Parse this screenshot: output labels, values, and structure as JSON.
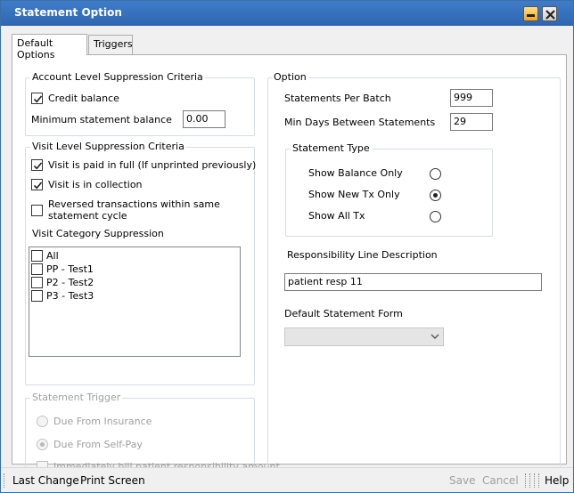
{
  "window": {
    "title": "Statement Option"
  },
  "tabs": [
    {
      "label": "Default Options",
      "active": true
    },
    {
      "label": "Triggers",
      "active": false
    }
  ],
  "account_level": {
    "title": "Account Level Suppression Criteria",
    "credit_balance_label": "Credit balance",
    "credit_balance_checked": true,
    "min_balance_label": "Minimum statement balance",
    "min_balance_value": "0.00"
  },
  "visit_level": {
    "title": "Visit Level Suppression Criteria",
    "paid_in_full_label": "Visit is paid in full (If unprinted previously)",
    "paid_in_full_checked": true,
    "in_collection_label": "Visit is in collection",
    "in_collection_checked": true,
    "reversed_line1": "Reversed transactions within same",
    "reversed_line2": "statement cycle",
    "reversed_checked": false,
    "category_title": "Visit Category Suppression",
    "categories": [
      {
        "label": "All",
        "checked": false
      },
      {
        "label": "PP - Test1",
        "checked": false
      },
      {
        "label": "P2 - Test2",
        "checked": false
      },
      {
        "label": "P3 - Test3",
        "checked": false
      }
    ]
  },
  "statement_trigger": {
    "title": "Statement Trigger",
    "due_insurance_label": "Due From Insurance",
    "due_selfpay_label": "Due From Self-Pay",
    "selected": "Due From Self-Pay",
    "immediately_bill_label": "Immediately bill patient responsibility amount",
    "immediately_bill_checked": false
  },
  "option": {
    "title": "Option",
    "statements_per_batch_label": "Statements Per Batch",
    "statements_per_batch_value": "999",
    "min_days_label": "Min Days Between Statements",
    "min_days_value": "29",
    "statement_type": {
      "title": "Statement Type",
      "options": [
        "Show Balance Only",
        "Show New Tx Only",
        "Show All Tx"
      ],
      "selected": "Show New Tx Only"
    },
    "resp_line_label": "Responsibility Line Description",
    "resp_line_value": "patient resp 11",
    "default_form_label": "Default Statement Form",
    "default_form_value": ""
  },
  "statusbar": {
    "last_change": "Last Change",
    "print_screen": "Print Screen",
    "save": "Save",
    "cancel": "Cancel",
    "help": "Help"
  },
  "colors": {
    "title_bar": "#2f66b0",
    "disabled_text": "#a0a0a0"
  }
}
